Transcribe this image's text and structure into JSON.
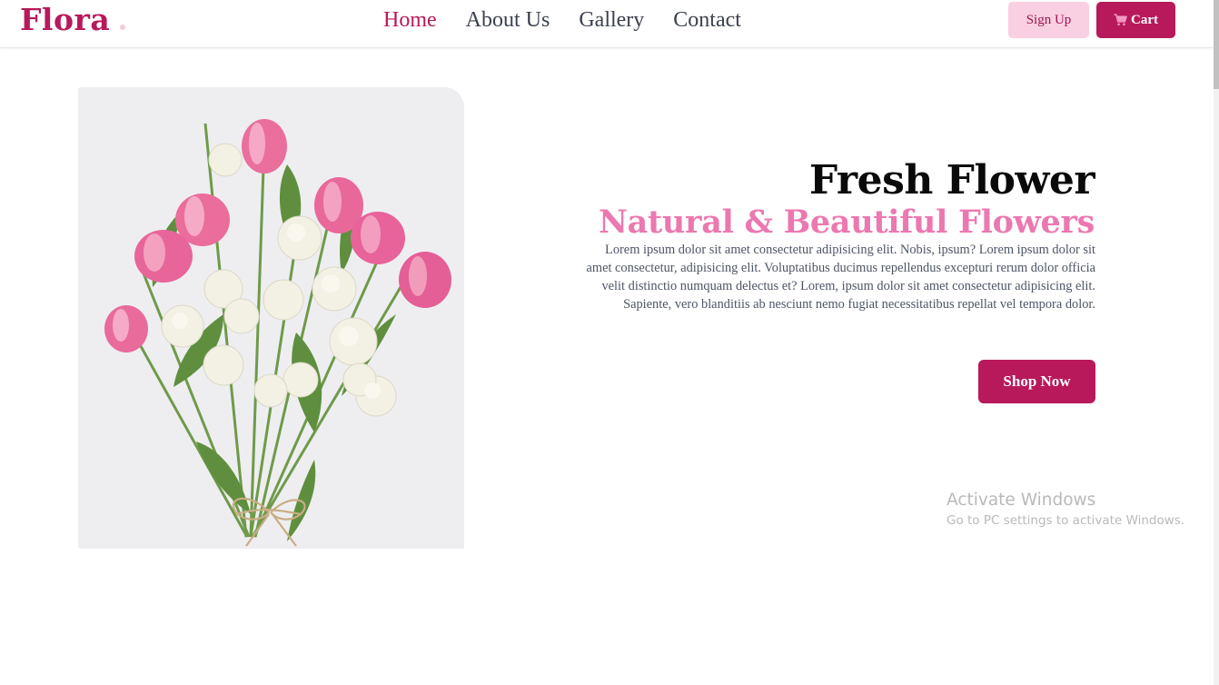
{
  "brand": {
    "name": "Flora",
    "color": "#b8195a"
  },
  "nav": {
    "links": [
      {
        "label": "Home",
        "active": true
      },
      {
        "label": "About Us",
        "active": false
      },
      {
        "label": "Gallery",
        "active": false
      },
      {
        "label": "Contact",
        "active": false
      }
    ],
    "signup_label": "Sign Up",
    "cart_label": "Cart",
    "cart_icon": "shopping-cart-icon"
  },
  "hero": {
    "image_alt": "bouquet of pink tulips and white lisianthus flowers",
    "title": "Fresh Flower",
    "subtitle": "Natural & Beautiful Flowers",
    "description": "Lorem ipsum dolor sit amet consectetur adipisicing elit. Nobis, ipsum? Lorem ipsum dolor sit amet consectetur, adipisicing elit. Voluptatibus ducimus repellendus excepturi rerum dolor officia velit distinctio numquam delectus et? Lorem, ipsum dolor sit amet consectetur adipisicing elit. Sapiente, vero blanditiis ab nesciunt nemo fugiat necessitatibus repellat vel tempora dolor.",
    "cta_label": "Shop Now"
  },
  "watermark": {
    "title": "Activate Windows",
    "subtitle": "Go to PC settings to activate Windows."
  },
  "colors": {
    "accent": "#b8195a",
    "accent_light": "#f9cfe2",
    "subtitle_pink": "#ec78b0",
    "text_gray": "#4e5566"
  }
}
